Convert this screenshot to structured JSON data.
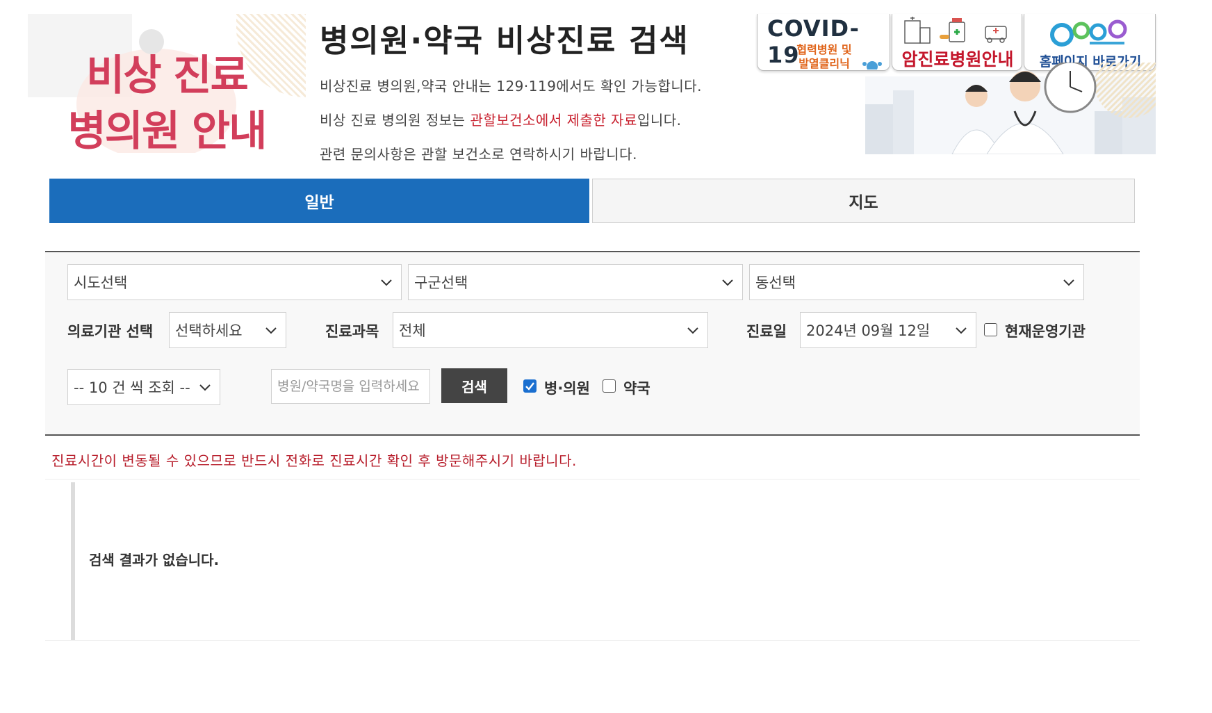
{
  "header": {
    "hero_line1": "비상 진료",
    "hero_line2": "병의원 안내",
    "title": "병의원·약국 비상진료 검색",
    "info1": "비상진료 병의원,약국 안내는 129·119에서도 확인 가능합니다.",
    "info2_pre": "비상 진료 병의원 정보는 ",
    "info2_highlight": "관할보건소에서 제출한 자료",
    "info2_post": "입니다.",
    "info3": "관련 문의사항은 관할 보건소로 연락하시기 바랍니다."
  },
  "banners": {
    "covid_title": "COVID-19",
    "covid_sub1": "협력병원 및",
    "covid_sub2": "발열클리닉",
    "cancer_label": "암진료병원안내",
    "home_label": "홈페이지 바로가기"
  },
  "tabs": {
    "general": "일반",
    "map": "지도"
  },
  "search": {
    "sido": "시도선택",
    "gugun": "구군선택",
    "dong": "동선택",
    "inst_label": "의료기관 선택",
    "inst_value": "선택하세요",
    "dept_label": "진료과목",
    "dept_value": "전체",
    "date_label": "진료일",
    "date_value": "2024년 09월 12일",
    "open_now_label": "현재운영기관",
    "page_size": "-- 10 건 씩 조회 --",
    "name_placeholder": "병원/약국명을 입력하세요",
    "search_button": "검색",
    "hospital_label": "병·의원",
    "pharmacy_label": "약국"
  },
  "notice": "진료시간이 변동될 수 있으므로 반드시 전화로 진료시간 확인 후 방문해주시기 바랍니다.",
  "results": {
    "empty_message": "검색 결과가 없습니다."
  },
  "colors": {
    "primary": "#1b6dbb",
    "alert": "#b71c2a",
    "hero": "#d23e5b"
  }
}
